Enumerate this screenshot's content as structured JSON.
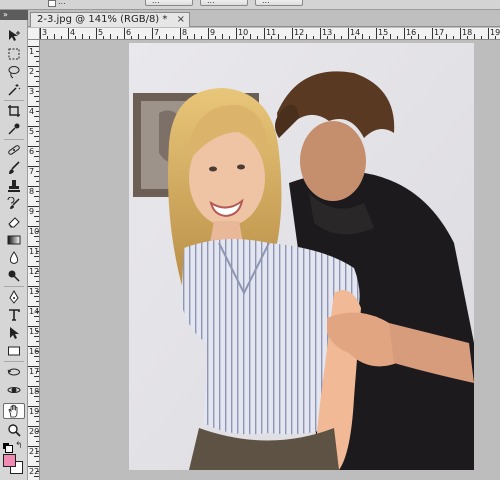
{
  "options_bar": {
    "checkbox_label": "...",
    "buttons": [
      "...",
      "...",
      "..."
    ]
  },
  "panel_strip": {
    "label": "»"
  },
  "document": {
    "tab_title": "2-3.jpg @ 141% (RGB/8) *",
    "close_glyph": "×"
  },
  "ruler": {
    "horizontal_labels": [
      "3",
      "4",
      "5",
      "6",
      "7",
      "8",
      "9",
      "10",
      "11",
      "12",
      "13",
      "14",
      "15",
      "16",
      "17",
      "18",
      "19",
      "20"
    ],
    "vertical_labels": [
      "1",
      "2",
      "3",
      "4",
      "5",
      "6",
      "7",
      "8",
      "9",
      "10",
      "11",
      "12",
      "13",
      "14",
      "15",
      "16",
      "17",
      "18",
      "19",
      "20",
      "21",
      "22"
    ]
  },
  "toolbox": {
    "tools": [
      {
        "name": "move-tool",
        "icon": "move-icon"
      },
      {
        "name": "marquee-tool",
        "icon": "marquee-icon"
      },
      {
        "name": "lasso-tool",
        "icon": "lasso-icon"
      },
      {
        "name": "magic-wand-tool",
        "icon": "magic-wand-icon"
      },
      {
        "name": "crop-tool",
        "icon": "crop-icon"
      },
      {
        "name": "eyedropper-tool",
        "icon": "eyedropper-icon"
      },
      {
        "name": "healing-brush-tool",
        "icon": "healing-icon"
      },
      {
        "name": "brush-tool",
        "icon": "brush-icon"
      },
      {
        "name": "clone-stamp-tool",
        "icon": "stamp-icon"
      },
      {
        "name": "history-brush-tool",
        "icon": "history-brush-icon"
      },
      {
        "name": "eraser-tool",
        "icon": "eraser-icon"
      },
      {
        "name": "gradient-tool",
        "icon": "gradient-icon"
      },
      {
        "name": "blur-tool",
        "icon": "blur-drop-icon"
      },
      {
        "name": "dodge-tool",
        "icon": "dodge-icon"
      },
      {
        "name": "pen-tool",
        "icon": "pen-icon"
      },
      {
        "name": "type-tool",
        "icon": "type-icon"
      },
      {
        "name": "path-selection-tool",
        "icon": "arrow-icon"
      },
      {
        "name": "shape-tool",
        "icon": "rectangle-icon"
      },
      {
        "name": "3d-rotate-tool",
        "icon": "rotate-3d-icon"
      },
      {
        "name": "3d-orbit-tool",
        "icon": "orbit-icon"
      },
      {
        "name": "hand-tool",
        "icon": "hand-icon",
        "selected": true
      },
      {
        "name": "zoom-tool",
        "icon": "zoom-icon"
      }
    ],
    "foreground_color": "#f08cb4",
    "background_color": "#ffffff"
  },
  "colors": {
    "ui_gray": "#d6d6d6",
    "canvas_bg": "#bdbdbd"
  }
}
